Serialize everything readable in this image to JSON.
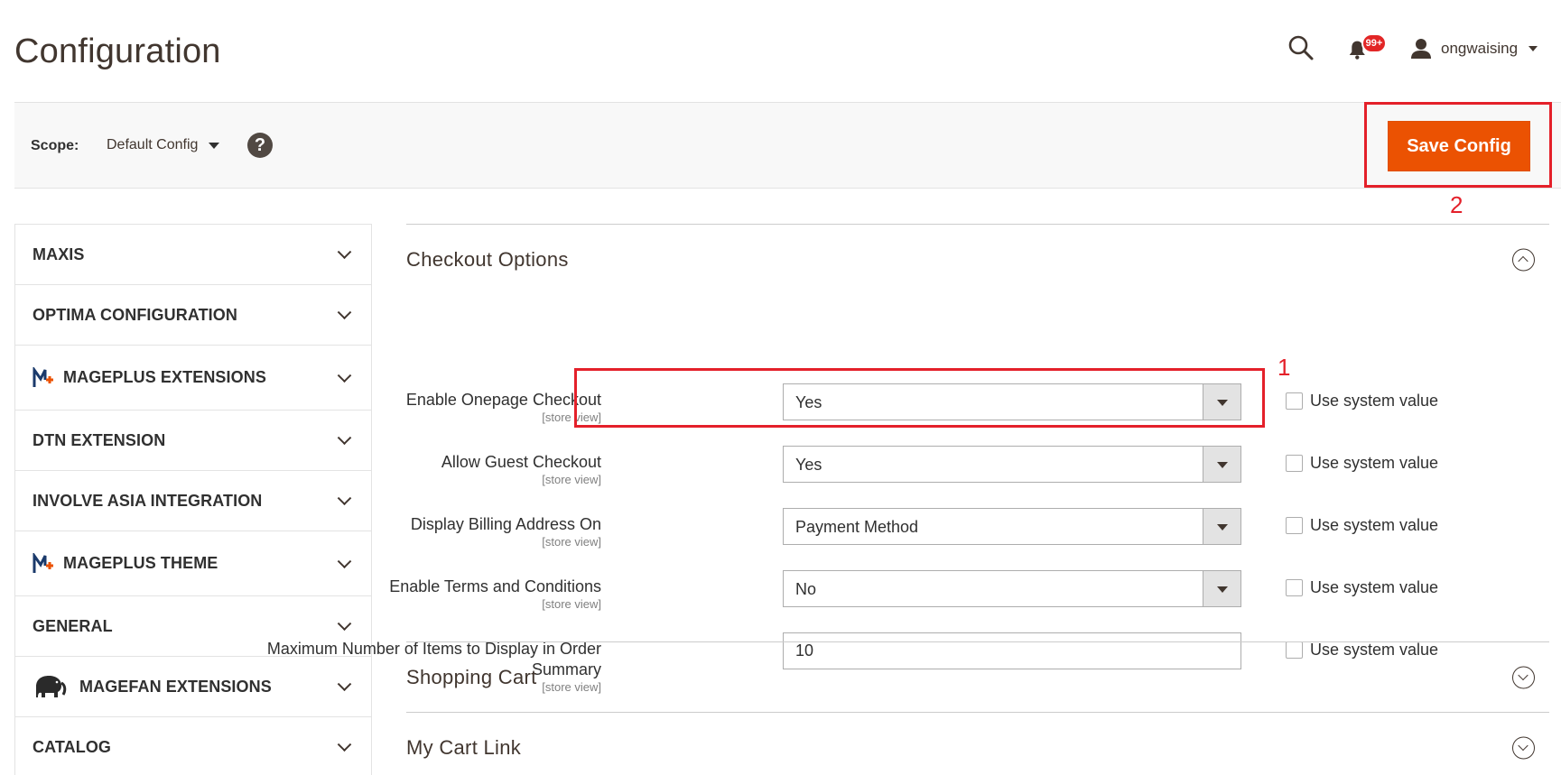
{
  "header": {
    "title": "Configuration",
    "notifications_badge": "99+",
    "username": "ongwaising"
  },
  "scope_bar": {
    "label": "Scope:",
    "value": "Default Config",
    "help": "?",
    "save_label": "Save Config"
  },
  "annotations": {
    "first": "1",
    "second": "2"
  },
  "sidebar": {
    "items": [
      {
        "label": "MAXIS"
      },
      {
        "label": "OPTIMA CONFIGURATION"
      },
      {
        "label": "MAGEPLUS EXTENSIONS",
        "icon": "mageplus-logo-icon"
      },
      {
        "label": "DTN EXTENSION"
      },
      {
        "label": "INVOLVE ASIA INTEGRATION"
      },
      {
        "label": "MAGEPLUS THEME",
        "icon": "mageplus-logo-icon"
      },
      {
        "label": "GENERAL"
      },
      {
        "label": "MAGEFAN EXTENSIONS",
        "icon": "elephant-icon"
      },
      {
        "label": "CATALOG"
      }
    ]
  },
  "sections": {
    "checkout_options": {
      "title": "Checkout Options",
      "fields": [
        {
          "label": "Enable Onepage Checkout",
          "scope": "[store view]",
          "value": "Yes",
          "system_value_label": "Use system value"
        },
        {
          "label": "Allow Guest Checkout",
          "scope": "[store view]",
          "value": "Yes",
          "system_value_label": "Use system value"
        },
        {
          "label": "Display Billing Address On",
          "scope": "[store view]",
          "value": "Payment Method",
          "system_value_label": "Use system value"
        },
        {
          "label": "Enable Terms and Conditions",
          "scope": "[store view]",
          "value": "No",
          "system_value_label": "Use system value"
        },
        {
          "label_line1": "Maximum Number of Items to Display in Order",
          "label_line2": "Summary",
          "scope": "[store view]",
          "value": "10",
          "system_value_label": "Use system value"
        }
      ]
    },
    "shopping_cart": {
      "title": "Shopping Cart"
    },
    "my_cart_link": {
      "title": "My Cart Link"
    }
  },
  "colors": {
    "accent": "#eb5202",
    "annotation": "#e4202a",
    "badge": "#e22626"
  }
}
